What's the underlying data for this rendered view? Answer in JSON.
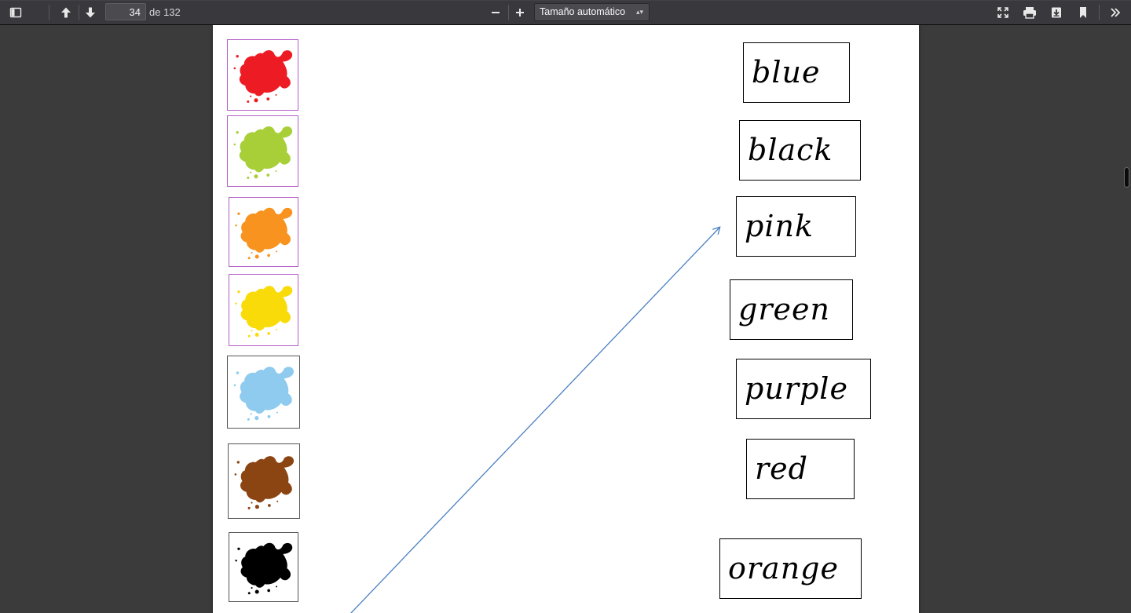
{
  "toolbar": {
    "page_number": "34",
    "page_count": "de 132",
    "zoom_label": "Tamaño automático",
    "icons": {
      "sidebar": "sidebar-toggle-icon",
      "prev": "arrow-up-icon",
      "next": "arrow-down-icon",
      "zoom_out": "minus-icon",
      "zoom_in": "plus-icon",
      "presentation": "fullscreen-icon",
      "print": "print-icon",
      "download": "download-icon",
      "bookmark": "bookmark-icon",
      "tools": "double-chevron-icon"
    }
  },
  "document": {
    "swatches": [
      {
        "color_name": "red",
        "color": "#ed1c24",
        "border": "#b45fc7"
      },
      {
        "color_name": "lime",
        "color": "#a8cf38",
        "border": "#b45fc7"
      },
      {
        "color_name": "orange",
        "color": "#f7931e",
        "border": "#b45fc7"
      },
      {
        "color_name": "yellow",
        "color": "#fadb0a",
        "border": "#b45fc7"
      },
      {
        "color_name": "light-blue",
        "color": "#8ecbef",
        "border": "#555555"
      },
      {
        "color_name": "brown",
        "color": "#8b4513",
        "border": "#555555"
      },
      {
        "color_name": "black",
        "color": "#000000",
        "border": "#555555"
      }
    ],
    "words": [
      "blue",
      "black",
      "pink",
      "green",
      "purple",
      "red",
      "orange"
    ],
    "arrow_color": "#4a7fc1"
  }
}
